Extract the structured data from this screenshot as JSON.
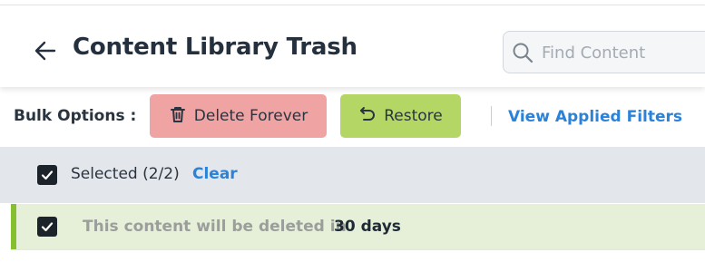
{
  "header": {
    "title": "Content Library Trash",
    "back_icon": "arrow-left-icon",
    "search": {
      "placeholder": "Find Content",
      "value": "",
      "icon": "search-icon"
    }
  },
  "bulk": {
    "label": "Bulk Options :",
    "delete_label": "Delete Forever",
    "delete_icon": "trash-icon",
    "restore_label": "Restore",
    "restore_icon": "undo-icon",
    "filters_link": "View Applied Filters"
  },
  "selection": {
    "text": "Selected (2/2)",
    "clear_label": "Clear",
    "checked": true
  },
  "rows": [
    {
      "text": "This content will be deleted in",
      "days": "30 days",
      "checked": true
    }
  ],
  "colors": {
    "title": "#25303f",
    "link": "#2a82d9",
    "delete_bg": "#f0a3a3",
    "restore_bg": "#b4d665",
    "row_accent": "#86bf2f",
    "row_bg": "#e6f0d9",
    "selection_bg": "#e3e6ea"
  }
}
